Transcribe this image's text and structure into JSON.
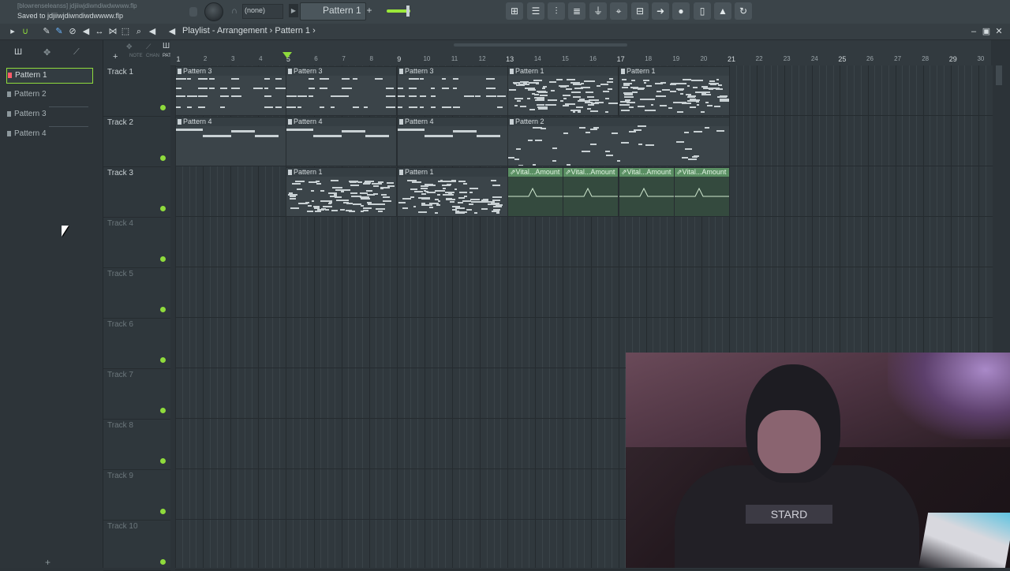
{
  "topbar": {
    "project_name": "[blowrenseleanss] jdjiiwjdiwndiwdwwww.flp",
    "saved_message": "Saved to jdjiiwjdiwndiwdwwww.flp",
    "preset": "(none)",
    "pattern_selector": "Pattern 1",
    "pattern_add": "+"
  },
  "playlist": {
    "title": "Playlist - Arrangement",
    "pattern": "Pattern 1",
    "separator": "›"
  },
  "picker": {
    "items": [
      "Pattern 1",
      "Pattern 2",
      "Pattern 3",
      "Pattern 4"
    ],
    "selected": "Pattern 1",
    "add": "+"
  },
  "tracks": [
    "Track 1",
    "Track 2",
    "Track 3",
    "Track 4",
    "Track 5",
    "Track 6",
    "Track 7",
    "Track 8",
    "Track 9",
    "Track 10"
  ],
  "ruler": {
    "bars": [
      "1",
      "2",
      "3",
      "4",
      "5",
      "6",
      "7",
      "8",
      "9",
      "10",
      "11",
      "12",
      "13",
      "14",
      "15",
      "16",
      "17",
      "18",
      "19",
      "20",
      "21",
      "22",
      "23",
      "24",
      "25",
      "26",
      "27",
      "28",
      "29",
      "30"
    ],
    "mini_tools": [
      "NOTE",
      "CHAN",
      "PAT"
    ]
  },
  "clips": {
    "track1": [
      "Pattern 3",
      "Pattern 3",
      "Pattern 3",
      "Pattern 1",
      "Pattern 1"
    ],
    "track2": [
      "Pattern 4",
      "Pattern 4",
      "Pattern 4",
      "Pattern 2"
    ],
    "track3": [
      "Pattern 1",
      "Pattern 1"
    ],
    "automation": [
      "Vital...Amount",
      "Vital...Amount",
      "Vital...Amount",
      "Vital...Amount"
    ]
  },
  "webcam": {
    "shirt_text": "STARD"
  },
  "colors": {
    "accent": "#8fdb3c",
    "background": "#2c3338",
    "clip": "#3b4449",
    "automation": "#5a8f63",
    "selected_marker": "#ff5c6a"
  }
}
